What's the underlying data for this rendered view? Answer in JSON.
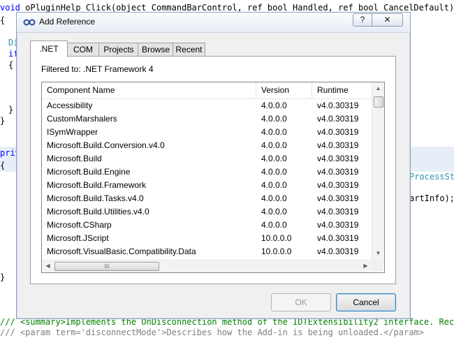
{
  "code_lines": {
    "l1": "oPluginHelp Click(object CommandBarControl, ref bool Handled, ref bool CancelDefault)",
    "l2": "{",
    "l3": "Di",
    "l4": "if",
    "l5": "{",
    "l6": "}",
    "l7": "}",
    "l8": "priv",
    "l9": "{",
    "l10": "ProcessSt",
    "l11": "artInfo);",
    "l12": "}",
    "l13": "/// <summary>Implements the OnDisconnection method of the IDTExtensibility2 interface. Receive",
    "l14": "/// <param term='disconnectMode'>Describes how the Add-in is being unloaded.</param>"
  },
  "dialog": {
    "title": "Add Reference",
    "help_label": "?",
    "close_label": "✕",
    "tabs": [
      ".NET",
      "COM",
      "Projects",
      "Browse",
      "Recent"
    ],
    "filter_text": "Filtered to: .NET Framework 4",
    "columns": [
      "Component Name",
      "Version",
      "Runtime"
    ],
    "rows": [
      [
        "Accessibility",
        "4.0.0.0",
        "v4.0.30319"
      ],
      [
        "CustomMarshalers",
        "4.0.0.0",
        "v4.0.30319"
      ],
      [
        "ISymWrapper",
        "4.0.0.0",
        "v4.0.30319"
      ],
      [
        "Microsoft.Build.Conversion.v4.0",
        "4.0.0.0",
        "v4.0.30319"
      ],
      [
        "Microsoft.Build",
        "4.0.0.0",
        "v4.0.30319"
      ],
      [
        "Microsoft.Build.Engine",
        "4.0.0.0",
        "v4.0.30319"
      ],
      [
        "Microsoft.Build.Framework",
        "4.0.0.0",
        "v4.0.30319"
      ],
      [
        "Microsoft.Build.Tasks.v4.0",
        "4.0.0.0",
        "v4.0.30319"
      ],
      [
        "Microsoft.Build.Utilities.v4.0",
        "4.0.0.0",
        "v4.0.30319"
      ],
      [
        "Microsoft.CSharp",
        "4.0.0.0",
        "v4.0.30319"
      ],
      [
        "Microsoft.JScript",
        "10.0.0.0",
        "v4.0.30319"
      ],
      [
        "Microsoft.VisualBasic.Compatibility.Data",
        "10.0.0.0",
        "v4.0.30319"
      ]
    ],
    "ok_label": "OK",
    "cancel_label": "Cancel",
    "scroll_grip": "III"
  }
}
